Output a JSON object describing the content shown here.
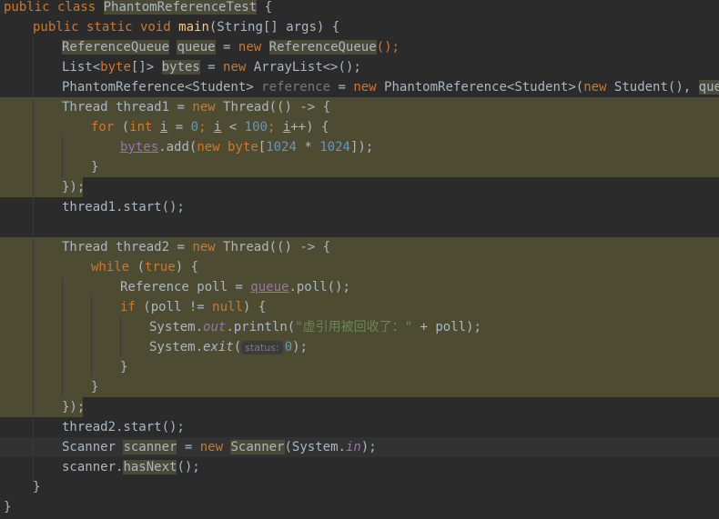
{
  "editor": {
    "class_keyword": "public class",
    "class_name": "PhantomReferenceTest",
    "main_sig_kw": "public static void",
    "main_name": "main",
    "main_params": "(String[] args) {",
    "line_queue": {
      "type": "ReferenceQueue",
      "var": "queue",
      "eq": " = ",
      "new": "new",
      "ctor": "ReferenceQueue",
      "rest": "();"
    },
    "line_bytes": {
      "type": "List<",
      "kw": "byte",
      "type2": "[]> ",
      "var": "bytes",
      "eq": " = ",
      "new": "new",
      "ctor": " ArrayList<>();"
    },
    "line_phantom": {
      "type": "PhantomReference<Student> ",
      "var": "reference",
      "eq": " = ",
      "new": "new",
      "ctor": " PhantomReference<Student>(",
      "new2": "new",
      "ctor2": " Student(), ",
      "arg": "queue",
      "rest": ");"
    },
    "thread1": {
      "type": "Thread ",
      "var": "thread1",
      "eq": " = ",
      "new": "new",
      "rest": " Thread(() -> {"
    },
    "for_line": {
      "kw": "for",
      "p1": " (",
      "kw2": "int",
      "p2": " ",
      "i1": "i",
      "p3": " = ",
      "n0": "0",
      "p4": "; ",
      "i2": "i",
      "p5": " < ",
      "n100": "100",
      "p6": "; ",
      "i3": "i",
      "p7": "++) {"
    },
    "add_line": {
      "field": "bytes",
      "call": ".add(",
      "new": "new",
      "kw": " byte",
      "p1": "[",
      "n1": "1024",
      "op": " * ",
      "n2": "1024",
      "p2": "]);"
    },
    "close_brace": "}",
    "close_lambda": "});",
    "thread1_start": "thread1.start();",
    "thread2": {
      "type": "Thread ",
      "var": "thread2",
      "eq": " = ",
      "new": "new",
      "rest": " Thread(() -> {"
    },
    "while_line": {
      "kw": "while",
      "p1": " (",
      "kw2": "true",
      "p2": ") {"
    },
    "poll_line": {
      "type": "Reference poll = ",
      "field": "queue",
      "rest": ".poll();"
    },
    "if_line": {
      "kw": "if",
      "p1": " (poll != ",
      "kw2": "null",
      "p2": ") {"
    },
    "println_line": {
      "cls": "System.",
      "field": "out",
      "call": ".println(",
      "str": "\"虚引用被回收了：\"",
      "rest": " + poll);"
    },
    "exit_line": {
      "cls": "System.",
      "method": "exit",
      "p1": "(",
      "hint": "status:",
      "num": "0",
      "p2": ");"
    },
    "thread2_start": "thread2.start();",
    "scanner_line": {
      "type": "Scanner ",
      "var": "scanner",
      "eq": " = ",
      "new": "new",
      "ctor": "Scanner",
      "p1": "(System.",
      "field": "in",
      "p2": ");"
    },
    "hasnext_line": {
      "obj": "scanner.",
      "method": "hasNext",
      "rest": "();"
    }
  },
  "colors": {
    "background": "#2b2b2b",
    "keyword": "#cc7832",
    "method": "#ffc66d",
    "number": "#6897bb",
    "string": "#6a8759",
    "field": "#9876aa",
    "highlight": "#4d4b32"
  }
}
